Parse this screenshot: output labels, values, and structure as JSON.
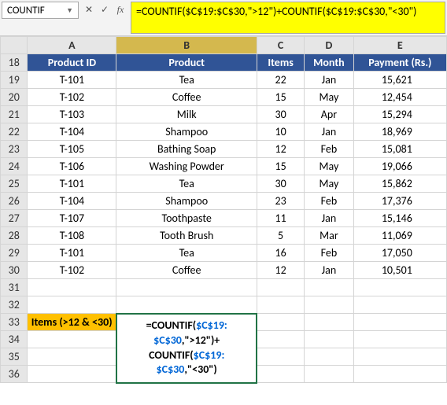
{
  "namebox": "COUNTIF",
  "formula_bar": "=COUNTIF($C$19:$C$30,\">12\")+COUNTIF($C$19:$C$30,\"<30\")",
  "columns": [
    "A",
    "B",
    "C",
    "D",
    "E"
  ],
  "headers": {
    "a": "Product ID",
    "b": "Product",
    "c": "Items",
    "d": "Month",
    "e": "Payment (Rs.)"
  },
  "rows": [
    {
      "n": 19,
      "a": "T-101",
      "b": "Tea",
      "c": "22",
      "d": "Jan",
      "e": "15,621"
    },
    {
      "n": 20,
      "a": "T-102",
      "b": "Coffee",
      "c": "15",
      "d": "May",
      "e": "12,454"
    },
    {
      "n": 21,
      "a": "T-103",
      "b": "Milk",
      "c": "30",
      "d": "Apr",
      "e": "15,294"
    },
    {
      "n": 22,
      "a": "T-104",
      "b": "Shampoo",
      "c": "10",
      "d": "Jan",
      "e": "18,969"
    },
    {
      "n": 23,
      "a": "T-105",
      "b": "Bathing Soap",
      "c": "12",
      "d": "Feb",
      "e": "15,081"
    },
    {
      "n": 24,
      "a": "T-106",
      "b": "Washing Powder",
      "c": "15",
      "d": "May",
      "e": "19,066"
    },
    {
      "n": 25,
      "a": "T-101",
      "b": "Tea",
      "c": "30",
      "d": "May",
      "e": "15,862"
    },
    {
      "n": 26,
      "a": "T-104",
      "b": "Shampoo",
      "c": "23",
      "d": "Feb",
      "e": "17,376"
    },
    {
      "n": 27,
      "a": "T-107",
      "b": "Toothpaste",
      "c": "11",
      "d": "Jan",
      "e": "15,146"
    },
    {
      "n": 28,
      "a": "T-108",
      "b": "Tooth Brush",
      "c": "5",
      "d": "Mar",
      "e": "11,069"
    },
    {
      "n": 29,
      "a": "T-101",
      "b": "Tea",
      "c": "16",
      "d": "Feb",
      "e": "17,050"
    },
    {
      "n": 30,
      "a": "T-102",
      "b": "Coffee",
      "c": "12",
      "d": "Jan",
      "e": "10,501"
    }
  ],
  "criteria_label": "Items (>12 & <30)",
  "formula_display": {
    "p1a": "=COUNTIF(",
    "p1b": "$C$19:",
    "p2a": "$C$30",
    "p2b": ",\">12\")+",
    "p3a": "COUNTIF(",
    "p3b": "$C$19:",
    "p4a": "$C$30",
    "p4b": ",\"<30\")"
  },
  "blank_rows": [
    31,
    32,
    34,
    35,
    36
  ]
}
